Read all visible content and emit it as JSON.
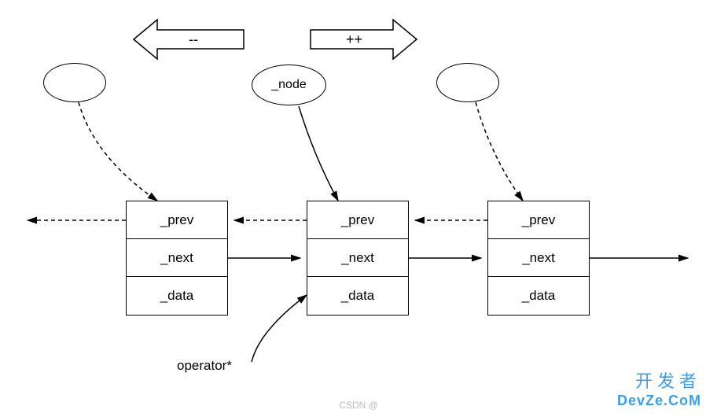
{
  "arrows": {
    "decrement": "--",
    "increment": "++"
  },
  "iterator": {
    "node_label": "_node"
  },
  "node_fields": {
    "prev": "_prev",
    "next": "_next",
    "data": "_data"
  },
  "labels": {
    "operator": "operator*"
  },
  "watermark": {
    "cn": "开发者",
    "en": "DevZe.CoM",
    "csdn": "CSDN @"
  }
}
